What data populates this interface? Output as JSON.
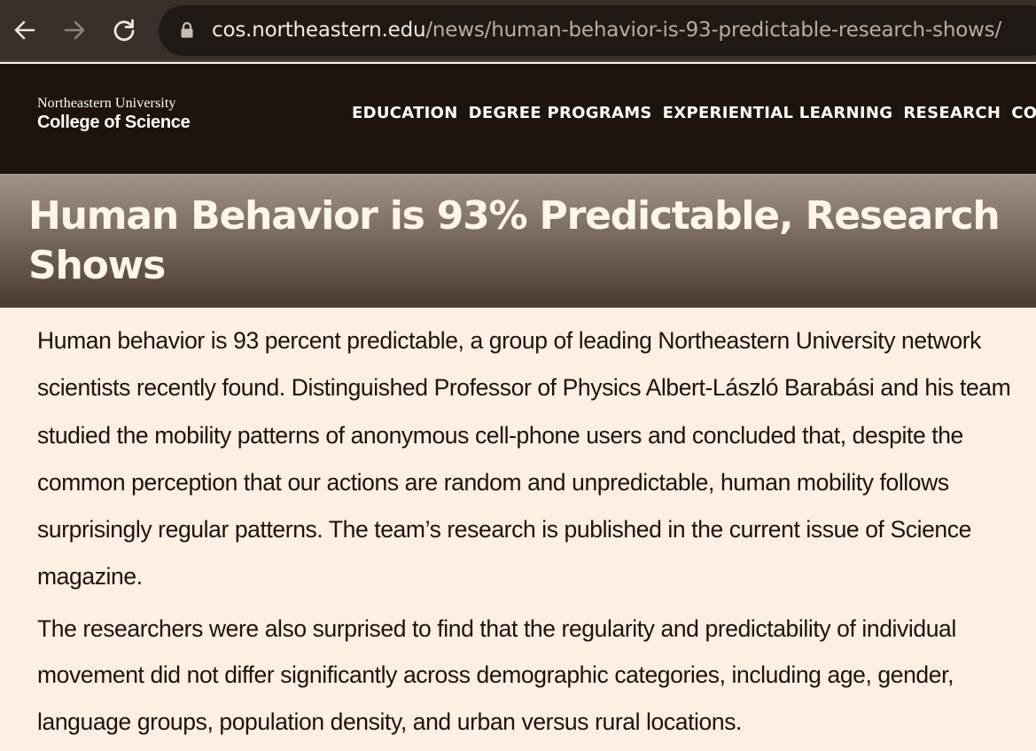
{
  "browser": {
    "url_host": "cos.northeastern.edu",
    "url_path": "/news/human-behavior-is-93-predictable-research-shows/",
    "back_icon": "arrow-left-icon",
    "forward_icon": "arrow-right-icon",
    "reload_icon": "reload-icon",
    "lock_icon": "lock-icon"
  },
  "site": {
    "logo_line1": "Northeastern University",
    "logo_line2": "College of Science",
    "nav": [
      "EDUCATION",
      "DEGREE PROGRAMS",
      "EXPERIENTIAL LEARNING",
      "RESEARCH",
      "COS LI"
    ]
  },
  "article": {
    "title": "Human Behavior is 93% Predictable, Research Shows",
    "paragraphs": [
      "Human behavior is 93 percent predictable, a group of leading Northeastern University network scientists recently found. Distinguished Professor of Physics Albert-László Barabási and his team studied the mobility patterns of anonymous cell-phone users and concluded that, despite the common perception that our actions are random and unpredictable, human mobility follows surprisingly regular patterns. The team’s research is published in the current issue of Science magazine.",
      "The researchers were also surprised to find that the regularity and predictability of individual movement did not differ significantly across demographic categories, including age, gender, language groups, population density, and urban versus rural locations."
    ]
  },
  "colors": {
    "chrome_bg": "#37302b",
    "omnibox_bg": "#201a16",
    "header_bg": "#1f140b",
    "page_bg": "#fdefe2",
    "title_text": "#fff5ea"
  }
}
